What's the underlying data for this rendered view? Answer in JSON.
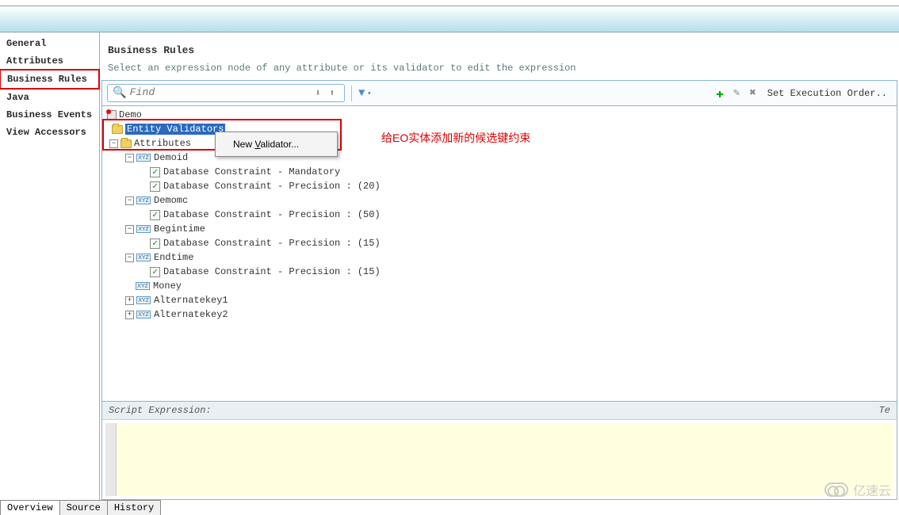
{
  "sidebar": {
    "items": [
      {
        "label": "General"
      },
      {
        "label": "Attributes"
      },
      {
        "label": "Business Rules",
        "selected": true
      },
      {
        "label": "Java"
      },
      {
        "label": "Business Events"
      },
      {
        "label": "View Accessors"
      }
    ]
  },
  "header": {
    "title": "Business Rules",
    "subtitle": "Select an expression node of any attribute or its validator to edit the expression"
  },
  "toolbar": {
    "search_placeholder": "Find",
    "exec_label": "Set Execution Order.."
  },
  "tree": {
    "root": "Demo",
    "entity_validators": "Entity Validators",
    "attributes": "Attributes",
    "nodes": [
      {
        "name": "Demoid",
        "constraints": [
          "Database Constraint - Mandatory",
          "Database Constraint - Precision :  (20)"
        ]
      },
      {
        "name": "Demomc",
        "constraints": [
          "Database Constraint - Precision :  (50)"
        ]
      },
      {
        "name": "Begintime",
        "constraints": [
          "Database Constraint - Precision :  (15)"
        ]
      },
      {
        "name": "Endtime",
        "constraints": [
          "Database Constraint - Precision :  (15)"
        ]
      },
      {
        "name": "Money",
        "constraints": []
      },
      {
        "name": "Alternatekey1",
        "constraints": [],
        "collapsed": true
      },
      {
        "name": "Alternatekey2",
        "constraints": [],
        "collapsed": true
      }
    ]
  },
  "context_menu": {
    "new_validator": "New Validator..."
  },
  "annotation": "给EO实体添加新的候选键约束",
  "script_panel": {
    "title": "Script Expression:",
    "right": "Te"
  },
  "bottom_tabs": [
    "Overview",
    "Source",
    "History"
  ],
  "watermark": "亿速云"
}
